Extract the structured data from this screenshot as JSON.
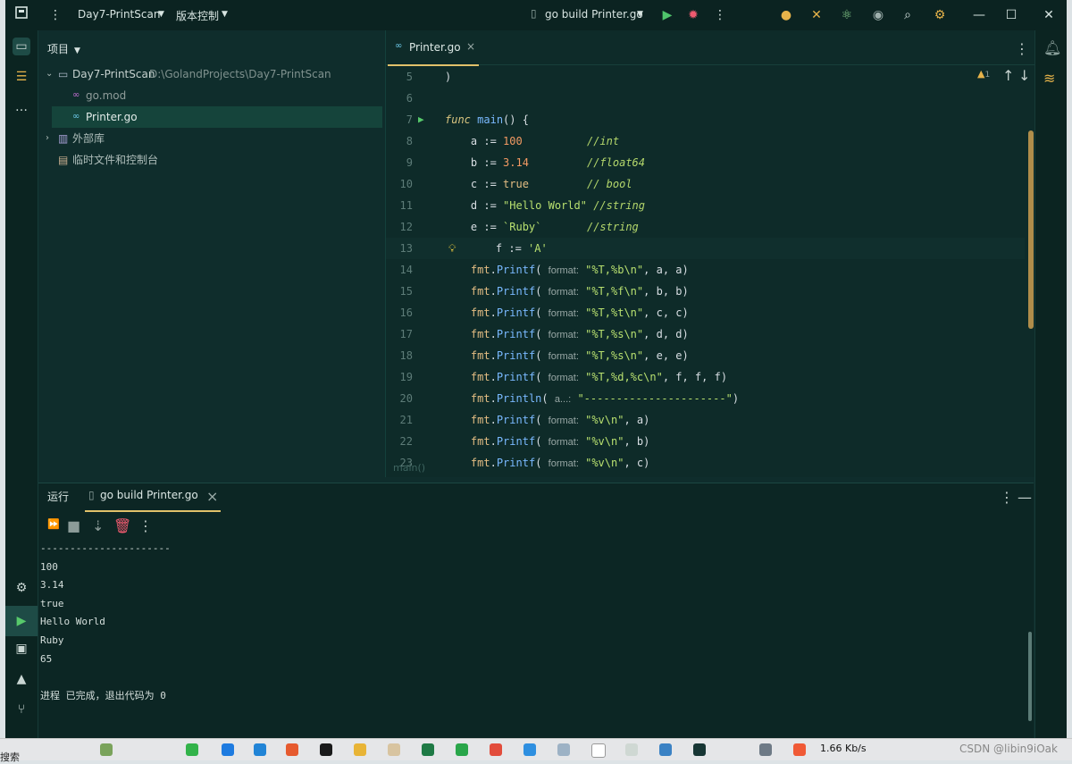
{
  "titlebar": {
    "project_name": "Day7-PrintScan",
    "vcs_label": "版本控制",
    "run_config": "go build Printer.go",
    "icons": [
      "app-logo-icon",
      "kebab-icon",
      "chevron-down-icon",
      "run-icon",
      "debug-icon",
      "more-icon",
      "collab-icon",
      "build-tools-icon",
      "atom-icon",
      "record-icon",
      "search-icon",
      "settings-icon",
      "minimize-icon",
      "maximize-icon",
      "close-icon"
    ]
  },
  "project_panel": {
    "title": "项目",
    "root_name": "Day7-PrintScan",
    "root_path": "D:\\GolandProjects\\Day7-PrintScan",
    "files": [
      "go.mod",
      "Printer.go"
    ],
    "external_libs": "外部库",
    "scratches": "临时文件和控制台"
  },
  "editor": {
    "tab_label": "Printer.go",
    "warning_count": "1",
    "breadcrumb": "main()",
    "hint_format": "format:",
    "hint_a": "a...:",
    "lines": [
      {
        "n": "5",
        "text": ")"
      },
      {
        "n": "6",
        "text": ""
      },
      {
        "n": "7",
        "text": "func main() {"
      },
      {
        "n": "8",
        "var": "a",
        "val": "100",
        "cmt": "//int"
      },
      {
        "n": "9",
        "var": "b",
        "val": "3.14",
        "cmt": "//float64"
      },
      {
        "n": "10",
        "var": "c",
        "val": "true",
        "cmt": "// bool"
      },
      {
        "n": "11",
        "var": "d",
        "val": "\"Hello World\"",
        "cmt": "//string"
      },
      {
        "n": "12",
        "var": "e",
        "val": "`Ruby`",
        "cmt": "//string"
      },
      {
        "n": "13",
        "var": "f",
        "val": "'A'",
        "cmt": ""
      },
      {
        "n": "14",
        "call": "Printf",
        "arg": "\"%T,%b\\n\"",
        "rest": ", a, a)"
      },
      {
        "n": "15",
        "call": "Printf",
        "arg": "\"%T,%f\\n\"",
        "rest": ", b, b)"
      },
      {
        "n": "16",
        "call": "Printf",
        "arg": "\"%T,%t\\n\"",
        "rest": ", c, c)"
      },
      {
        "n": "17",
        "call": "Printf",
        "arg": "\"%T,%s\\n\"",
        "rest": ", d, d)"
      },
      {
        "n": "18",
        "call": "Printf",
        "arg": "\"%T,%s\\n\"",
        "rest": ", e, e)"
      },
      {
        "n": "19",
        "call": "Printf",
        "arg": "\"%T,%d,%c\\n\"",
        "rest": ", f, f, f)"
      },
      {
        "n": "20",
        "call": "Println",
        "arg": "\"----------------------\"",
        "rest": ")"
      },
      {
        "n": "21",
        "call": "Printf",
        "arg": "\"%v\\n\"",
        "rest": ", a)"
      },
      {
        "n": "22",
        "call": "Printf",
        "arg": "\"%v\\n\"",
        "rest": ", b)"
      },
      {
        "n": "23",
        "call": "Printf",
        "arg": "\"%v\\n\"",
        "rest": ", c)"
      }
    ]
  },
  "run_panel": {
    "tab_run": "运行",
    "tab_config": "go build Printer.go",
    "output": [
      "----------------------",
      "100",
      "3.14",
      "true",
      "Hello World",
      "Ruby",
      "65",
      "",
      "进程 已完成，退出代码为 0"
    ]
  },
  "taskbar": {
    "search_label": "搜索",
    "net_speed": "1.66 Kb/s",
    "watermark": "CSDN @libin9iOak",
    "colors": {
      "accent": "#e0c16a",
      "ide_bg": "#0f2d2c",
      "console_bg": "#0c2624"
    }
  }
}
